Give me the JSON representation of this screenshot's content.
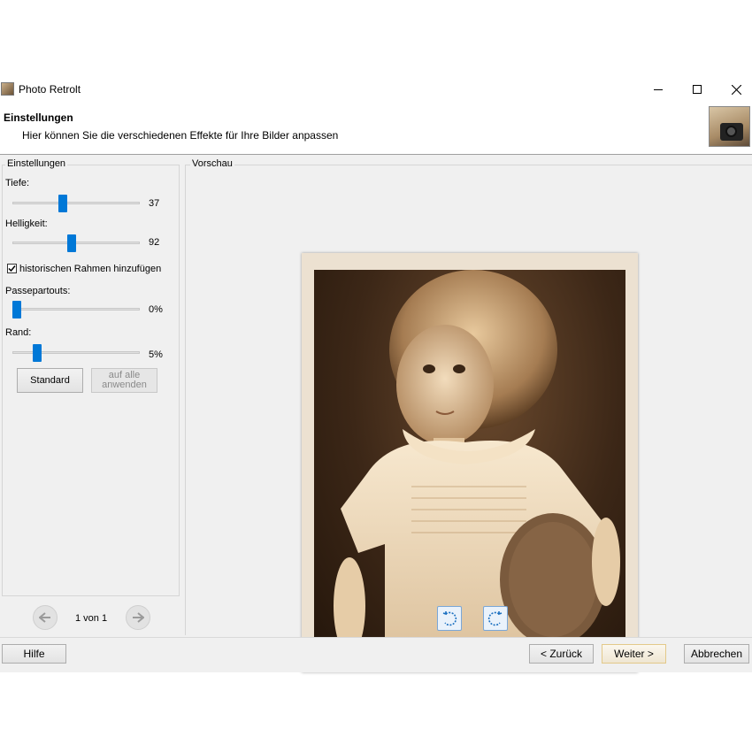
{
  "window": {
    "title": "Photo Retrolt",
    "buttons": {
      "minimize_icon": "minimize-icon",
      "maximize_icon": "maximize-icon",
      "close_icon": "close-icon"
    }
  },
  "header": {
    "title": "Einstellungen",
    "subtitle": "Hier können Sie die verschiedenen Effekte für Ihre Bilder anpassen"
  },
  "settings": {
    "group_label": "Einstellungen",
    "tiefe": {
      "label": "Tiefe:",
      "value": "37",
      "level": 0.38
    },
    "helligkeit": {
      "label": "Helligkeit:",
      "value": "92",
      "level": 0.46
    },
    "frame_checkbox": {
      "label": "historischen Rahmen hinzufügen",
      "checked": true
    },
    "passepartouts": {
      "label": "Passepartouts:",
      "value": "0%",
      "level": 0.0
    },
    "rand": {
      "label": "Rand:",
      "value": "5%",
      "level": 0.18
    },
    "standard_button": "Standard",
    "apply_all_button": "auf alle anwenden"
  },
  "navigation": {
    "counter": "1 von 1"
  },
  "preview": {
    "group_label": "Vorschau"
  },
  "footer": {
    "help": "Hilfe",
    "back": "< Zurück",
    "next": "Weiter >",
    "cancel": "Abbrechen"
  },
  "colors": {
    "accent": "#0078d7",
    "background": "#f0f0f0",
    "sepia_frame": "#ece1d1"
  }
}
